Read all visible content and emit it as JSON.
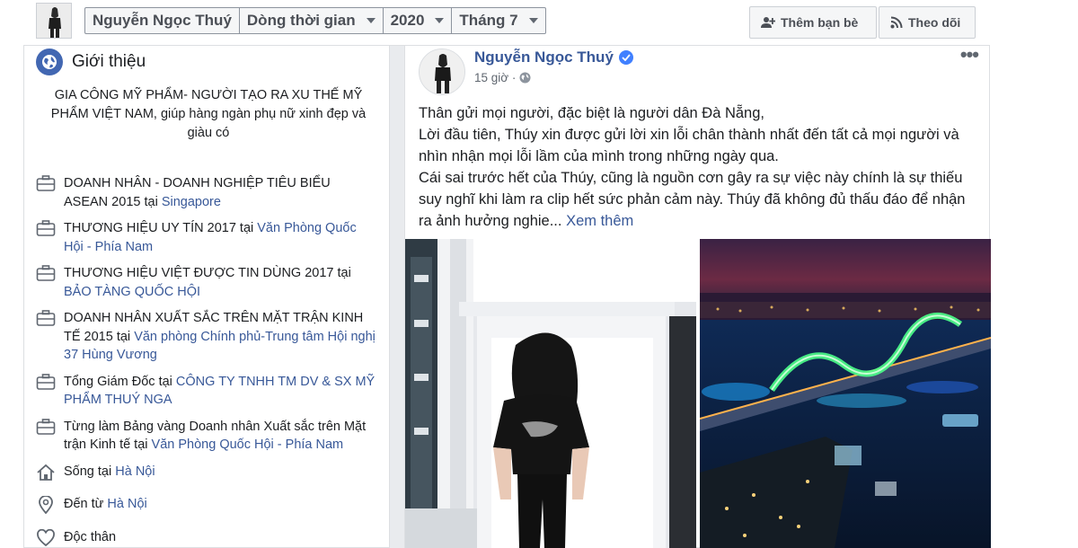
{
  "header": {
    "profile_name": "Nguyễn Ngọc Thuý",
    "timeline": "Dòng thời gian",
    "year": "2020",
    "month": "Tháng 7",
    "add_friend": "Thêm bạn bè",
    "follow": "Theo dõi"
  },
  "intro": {
    "title": "Giới thiệu",
    "bio": "GIA CÔNG MỸ PHẨM- NGƯỜI TẠO RA XU THẾ MỸ PHẨM VIỆT NAM, giúp hàng ngàn phụ nữ xinh đẹp và giàu có",
    "items": [
      {
        "icon": "briefcase-icon",
        "text": "DOANH NHÂN - DOANH NGHIỆP TIÊU BIỂU ASEAN 2015 tại ",
        "link": "Singapore"
      },
      {
        "icon": "briefcase-icon",
        "text": "THƯƠNG HIỆU UY TÍN 2017 tại ",
        "link": "Văn Phòng Quốc Hội - Phía Nam"
      },
      {
        "icon": "briefcase-icon",
        "text": "THƯƠNG HIỆU VIỆT ĐƯỢC TIN DÙNG 2017 tại ",
        "link": "BẢO TÀNG QUỐC HỘI"
      },
      {
        "icon": "briefcase-icon",
        "text": "DOANH NHÂN XUẤT SẮC TRÊN MẶT TRẬN KINH TẾ 2015 tại ",
        "link": "Văn phòng Chính phủ-Trung tâm Hội nghị 37 Hùng Vương"
      },
      {
        "icon": "briefcase-icon",
        "text": "Tổng Giám Đốc tại ",
        "link": "CÔNG TY TNHH TM DV & SX MỸ PHẨM THUÝ NGA"
      },
      {
        "icon": "briefcase-icon",
        "text": "Từng làm Bảng vàng Doanh nhân Xuất sắc trên Mặt trận Kinh tế tại ",
        "link": "Văn Phòng Quốc Hội - Phía Nam"
      },
      {
        "icon": "home-icon",
        "text": "Sống tại ",
        "link": "Hà Nội"
      },
      {
        "icon": "location-pin-icon",
        "text": "Đến từ ",
        "link": "Hà Nội"
      },
      {
        "icon": "heart-icon",
        "text": "Độc thân",
        "link": ""
      }
    ]
  },
  "post": {
    "author": "Nguyễn Ngọc Thuý",
    "time": "15 giờ ·",
    "lines": [
      "Thân gửi mọi người, đặc biệt là người dân Đà Nẵng,",
      "Lời đầu tiên, Thúy xin được gửi lời xin lỗi chân thành nhất đến tất cả mọi người và nhìn nhận mọi lỗi lầm của mình trong những ngày qua.",
      "Cái sai trước hết của Thúy, cũng là nguồn cơn gây ra sự việc này chính là sự thiếu suy nghĩ khi làm ra clip hết sức phản cảm này. Thúy đã không đủ thấu đáo để nhận ra ảnh hưởng nghie..."
    ],
    "see_more": "Xem thêm"
  }
}
